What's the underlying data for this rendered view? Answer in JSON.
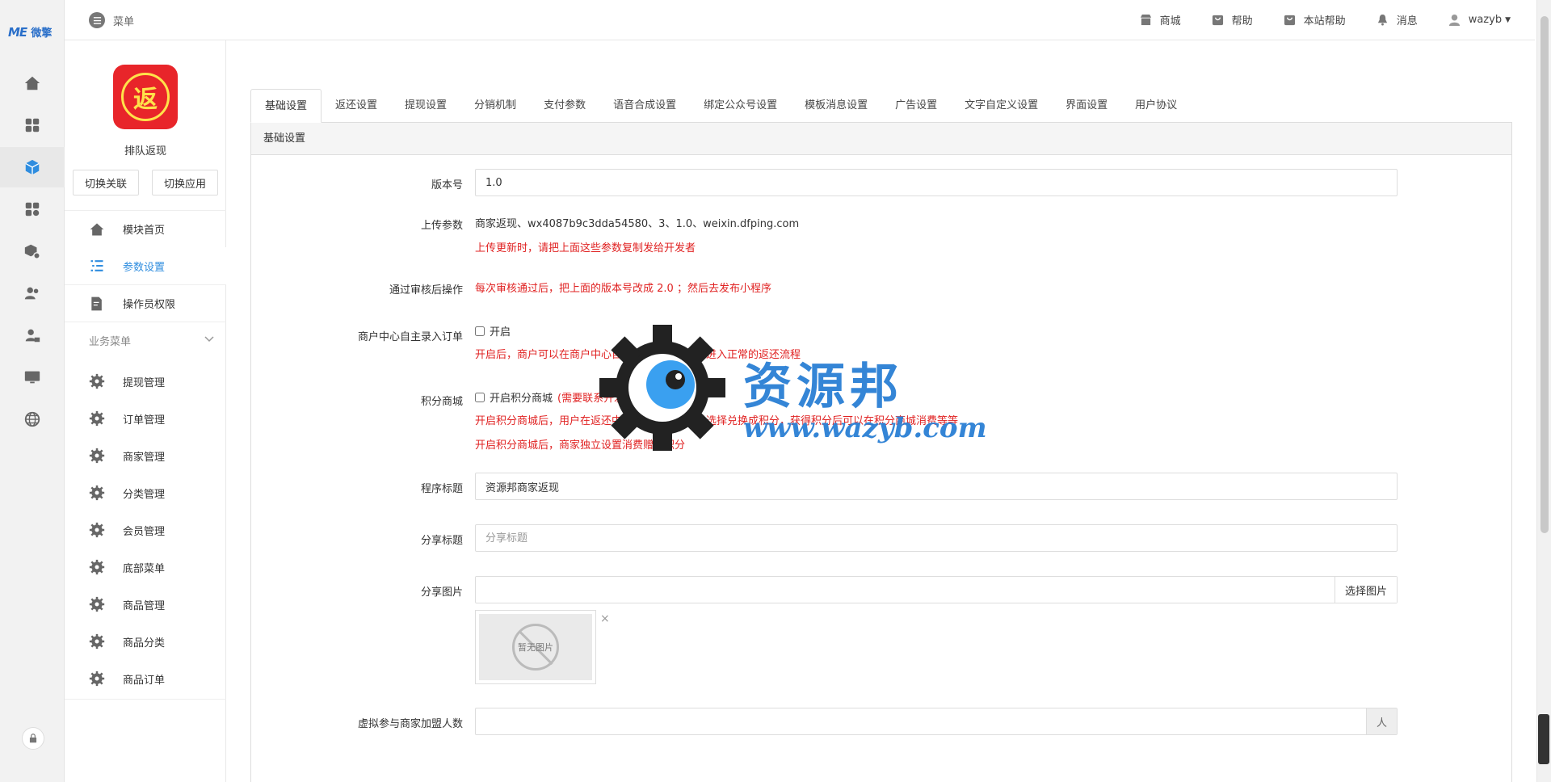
{
  "brand": {
    "logo_text": "ME",
    "logo_cn": "微擎"
  },
  "topbar": {
    "menu_label": "菜单",
    "links": [
      {
        "label": "商城",
        "icon": "store-icon"
      },
      {
        "label": "帮助",
        "icon": "help-bag-icon"
      },
      {
        "label": "本站帮助",
        "icon": "site-help-bag-icon"
      },
      {
        "label": "消息",
        "icon": "bell-icon"
      },
      {
        "label": "wazyb",
        "icon": "user-icon"
      }
    ]
  },
  "app": {
    "name": "排队返现",
    "logo_char": "返",
    "switch_relation": "切换关联",
    "switch_app": "切换应用"
  },
  "nav": [
    {
      "label": "模块首页",
      "icon": "home-icon"
    },
    {
      "label": "参数设置",
      "icon": "list-icon",
      "active": true
    },
    {
      "label": "操作员权限",
      "icon": "edit-doc-icon"
    }
  ],
  "biz_menu": {
    "title": "业务菜单",
    "items": [
      "提现管理",
      "订单管理",
      "商家管理",
      "分类管理",
      "会员管理",
      "底部菜单",
      "商品管理",
      "商品分类",
      "商品订单"
    ]
  },
  "tabs": [
    "基础设置",
    "返还设置",
    "提现设置",
    "分销机制",
    "支付参数",
    "语音合成设置",
    "绑定公众号设置",
    "模板消息设置",
    "广告设置",
    "文字自定义设置",
    "界面设置",
    "用户协议"
  ],
  "active_tab": 0,
  "panel_title": "基础设置",
  "form": {
    "version": {
      "label": "版本号",
      "value": "1.0"
    },
    "upload": {
      "label": "上传参数",
      "value": "商家返现、wx4087b9c3dda54580、3、1.0、weixin.dfping.com",
      "hint": "上传更新时，请把上面这些参数复制发给开发者"
    },
    "after_audit": {
      "label": "通过审核后操作",
      "hint": "每次审核通过后，把上面的版本号改成 2.0 ；然后去发布小程序"
    },
    "merchant_order": {
      "label": "商户中心自主录入订单",
      "check_label": "开启",
      "hint": "开启后，商户可以在商户中心自主录入订单，并且进入正常的返还流程"
    },
    "points_mall": {
      "label": "积分商城",
      "check_label": "开启积分商城",
      "check_note": "(需要联系开发者付费开通)",
      "hint1": "开启积分商城后，用户在返还中获得的积分，可以选择兑换成积分，获得积分后可以在积分商城消费等等",
      "hint2": "开启积分商城后，商家独立设置消费赠送积分"
    },
    "program_title": {
      "label": "程序标题",
      "value": "资源邦商家返现"
    },
    "share_title": {
      "label": "分享标题",
      "placeholder": "分享标题"
    },
    "share_image": {
      "label": "分享图片",
      "button": "选择图片",
      "no_image": "暂无图片",
      "close": "×"
    },
    "virtual_count": {
      "label": "虚拟参与商家加盟人数",
      "unit": "人"
    }
  },
  "watermark": {
    "title": "资源邦",
    "url": "www.wazyb.com"
  }
}
